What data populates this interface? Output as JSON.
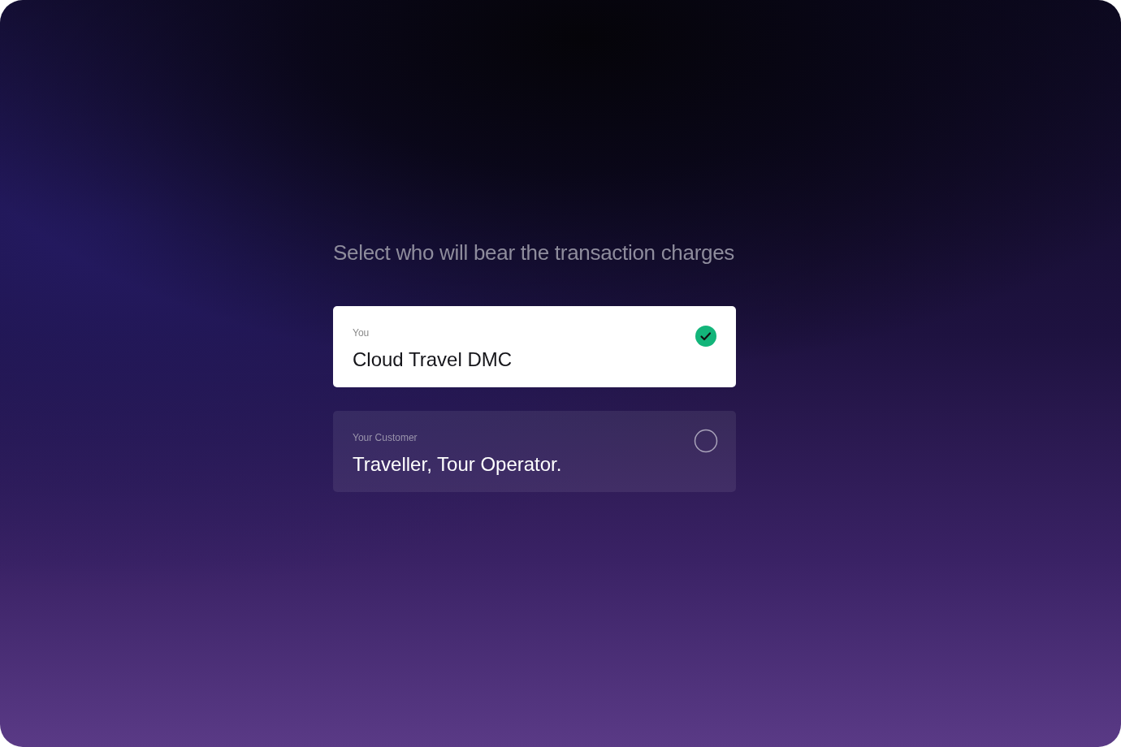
{
  "heading": "Select who will bear the transaction charges",
  "options": [
    {
      "label": "You",
      "title": "Cloud Travel DMC",
      "selected": true
    },
    {
      "label": "Your Customer",
      "title": "Traveller, Tour Operator.",
      "selected": false
    }
  ]
}
